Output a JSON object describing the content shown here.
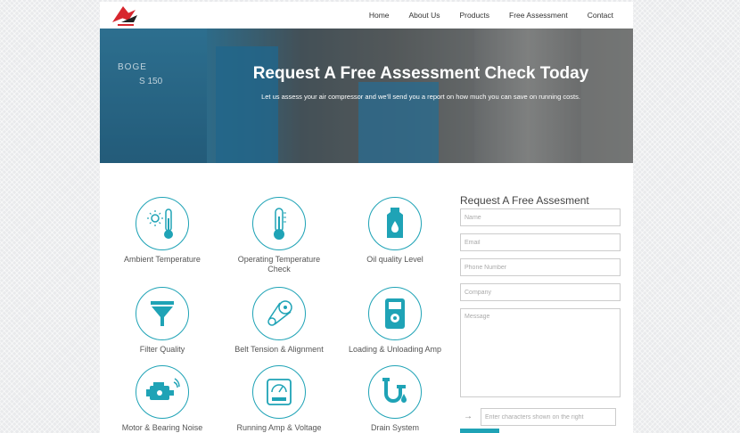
{
  "nav": {
    "items": [
      "Home",
      "About Us",
      "Products",
      "Free Assessment",
      "Contact"
    ]
  },
  "hero": {
    "title": "Request A Free Assessment Check Today",
    "subtitle": "Let us assess your air compressor and we'll send you a report on how much you can save on running costs.",
    "machine_brand": "BOGE",
    "machine_model": "S 150"
  },
  "features": [
    {
      "label": "Ambient Temperature",
      "icon": "thermometer-sun-icon"
    },
    {
      "label": "Operating Temperature Check",
      "icon": "thermometer-icon"
    },
    {
      "label": "Oil quality Level",
      "icon": "oil-bottle-icon"
    },
    {
      "label": "Filter Quality",
      "icon": "funnel-icon"
    },
    {
      "label": "Belt Tension & Alignment",
      "icon": "belt-icon"
    },
    {
      "label": "Loading & Unloading Amp",
      "icon": "meter-icon"
    },
    {
      "label": "Motor & Bearing Noise",
      "icon": "motor-icon"
    },
    {
      "label": "Running Amp & Voltage",
      "icon": "voltmeter-icon"
    },
    {
      "label": "Drain System",
      "icon": "drain-pipe-icon"
    }
  ],
  "form": {
    "title": "Request A Free Assesment",
    "name_placeholder": "Name",
    "email_placeholder": "Email",
    "phone_placeholder": "Phone Number",
    "company_placeholder": "Company",
    "message_placeholder": "Message",
    "captcha_placeholder": "Enter characters shown on the right"
  },
  "colors": {
    "accent": "#1fa3b6",
    "logo_red": "#d7262e"
  }
}
